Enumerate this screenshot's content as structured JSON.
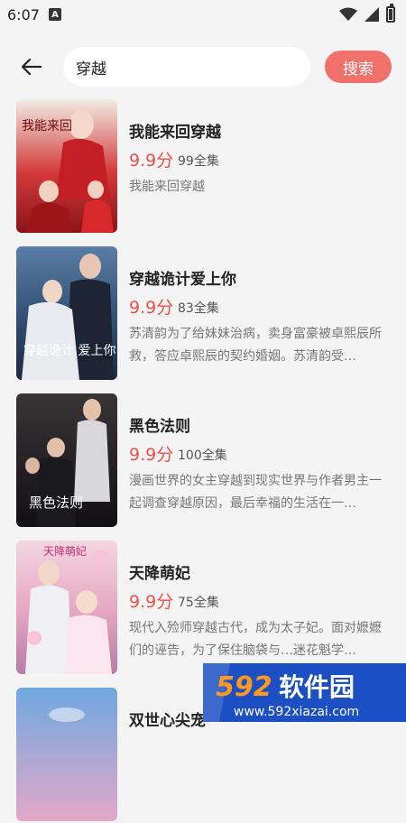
{
  "status_bar": {
    "time": "6:07",
    "badge": "A"
  },
  "search": {
    "value": "穿越",
    "button_label": "搜索"
  },
  "results": [
    {
      "title": "我能来回穿越",
      "score": "9.9分",
      "episodes": "99全集",
      "description": "我能来回穿越",
      "poster_text": "我能来回"
    },
    {
      "title": "穿越诡计爱上你",
      "score": "9.9分",
      "episodes": "83全集",
      "description": "苏清韵为了给妹妹治病，卖身富豪被卓熙辰所救，答应卓熙辰的契约婚姻。苏清韵受…",
      "poster_text": "穿越诡计 爱上你"
    },
    {
      "title": "黑色法则",
      "score": "9.9分",
      "episodes": "100全集",
      "description": "漫画世界的女主穿越到现实世界与作者男主一起调查穿越原因，最后幸福的生活在一…",
      "poster_text": "黑色法则"
    },
    {
      "title": "天降萌妃",
      "score": "9.9分",
      "episodes": "75全集",
      "description": "现代入殓师穿越古代，成为太子妃。面对嬷嬷们的诬告，为了保住脑袋与…迷花魁学…",
      "poster_text": "天降萌妃"
    },
    {
      "title": "双世心尖宠",
      "score": "",
      "episodes": "",
      "description": "",
      "poster_text": ""
    }
  ],
  "watermark": {
    "brand": "592软件园",
    "url": "www.592xiazai.com"
  },
  "colors": {
    "accent": "#f0716a",
    "score": "#f0504a",
    "background": "#f4f4f5"
  }
}
